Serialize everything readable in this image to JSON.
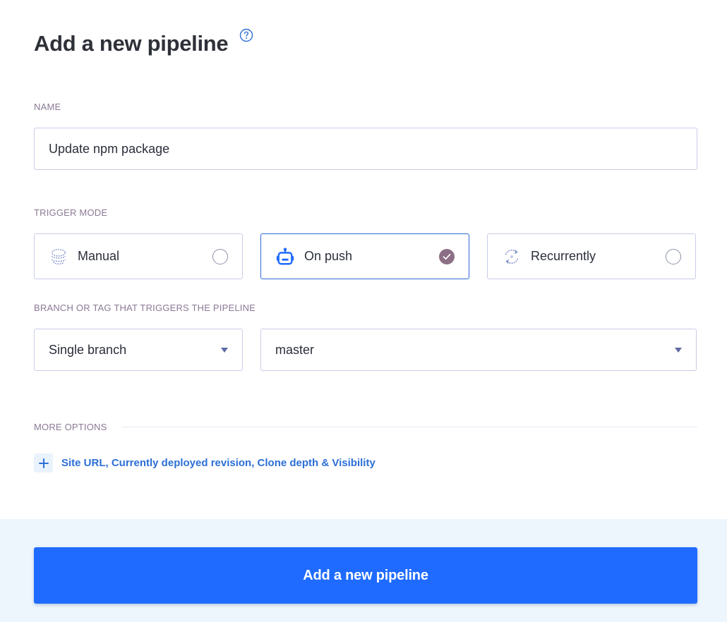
{
  "page": {
    "title": "Add a new pipeline",
    "help_icon": "question-circle-icon"
  },
  "name_section": {
    "label": "NAME",
    "value": "Update npm package"
  },
  "trigger_section": {
    "label": "TRIGGER MODE",
    "options": [
      {
        "label": "Manual",
        "icon": "hand-stack-icon",
        "selected": false
      },
      {
        "label": "On push",
        "icon": "robot-icon",
        "selected": true
      },
      {
        "label": "Recurrently",
        "icon": "refresh-cycle-icon",
        "selected": false
      }
    ]
  },
  "branch_section": {
    "label": "BRANCH OR TAG THAT TRIGGERS THE PIPELINE",
    "mode_value": "Single branch",
    "branch_value": "master"
  },
  "more_options": {
    "label": "MORE OPTIONS",
    "expand_text": "Site URL, Currently deployed revision, Clone depth & Visibility"
  },
  "footer": {
    "submit_label": "Add a new pipeline"
  },
  "colors": {
    "primary": "#1f6bff",
    "link": "#2c6fd6",
    "selected_border": "#2d69d6",
    "check": "#8c6f86",
    "footer_bg": "#eef6fd"
  }
}
